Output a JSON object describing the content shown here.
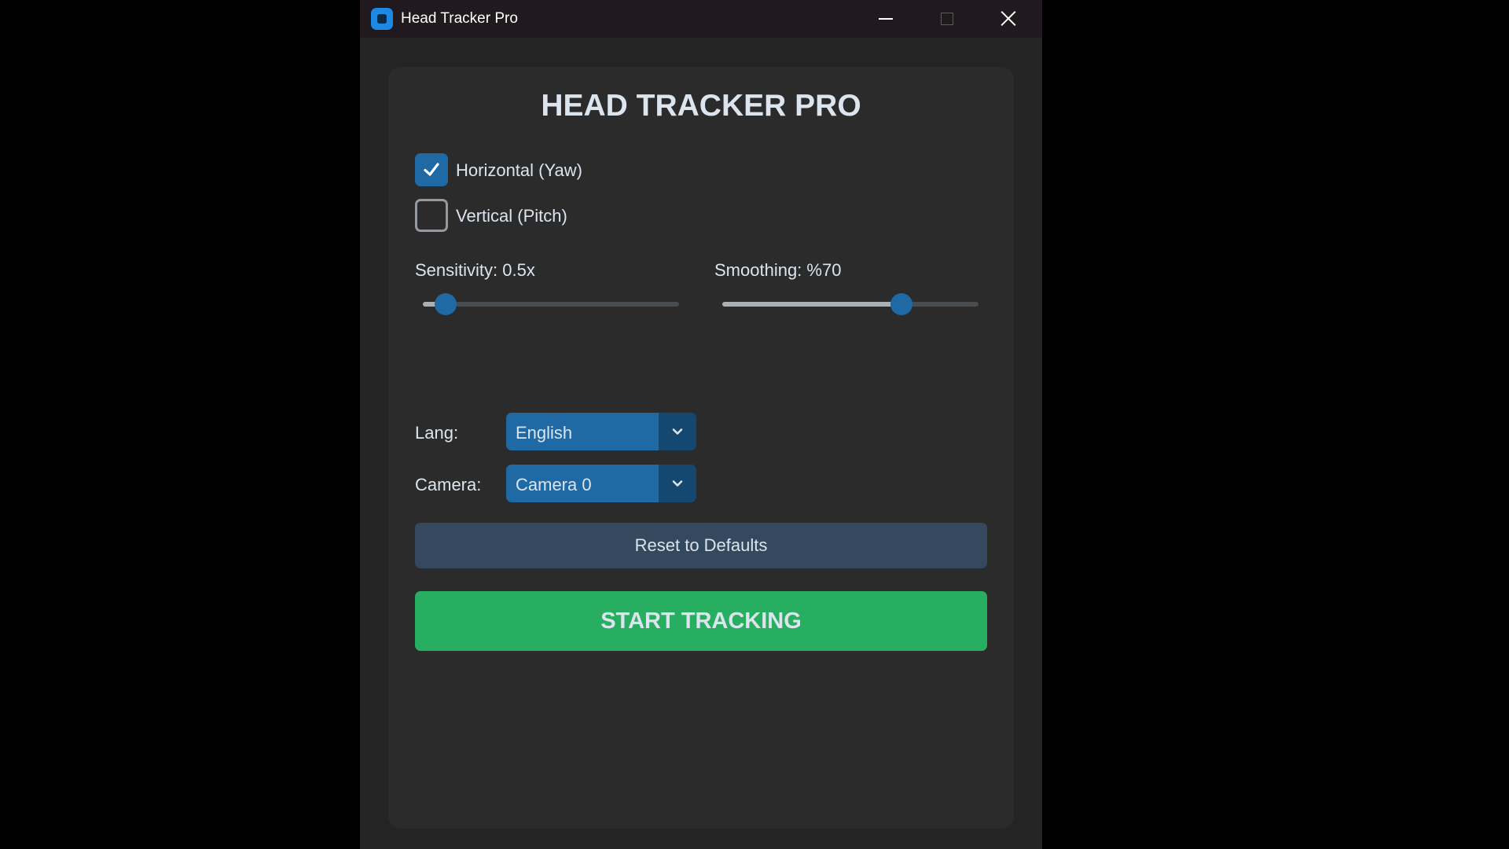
{
  "window": {
    "title": "Head Tracker Pro",
    "app_icon": "app-icon",
    "controls": {
      "minimize_icon": "minimize-icon",
      "maximize_icon": "maximize-icon",
      "close_icon": "close-icon"
    }
  },
  "panel": {
    "heading": "HEAD TRACKER PRO",
    "axes": [
      {
        "label": "Horizontal (Yaw)",
        "checked": true
      },
      {
        "label": "Vertical (Pitch)",
        "checked": false
      }
    ],
    "sensitivity": {
      "label": "Sensitivity: 0.5x",
      "value_fraction": 0.09
    },
    "smoothing": {
      "label": "Smoothing: %70",
      "value_fraction": 0.7
    },
    "language": {
      "label": "Lang:",
      "selected": "English",
      "arrow_icon": "chevron-down-icon"
    },
    "camera": {
      "label": "Camera:",
      "selected": "Camera 0",
      "arrow_icon": "chevron-down-icon"
    },
    "reset_label": "Reset to Defaults",
    "start_label": "START TRACKING"
  },
  "colors": {
    "accent": "#1f6aa5",
    "accent_dark": "#144870",
    "reset_button": "#34495e",
    "start_button": "#27ae60",
    "panel": "#2b2b2b",
    "window": "#242424",
    "titlebar": "#201a1e",
    "text": "#dce4ee"
  }
}
